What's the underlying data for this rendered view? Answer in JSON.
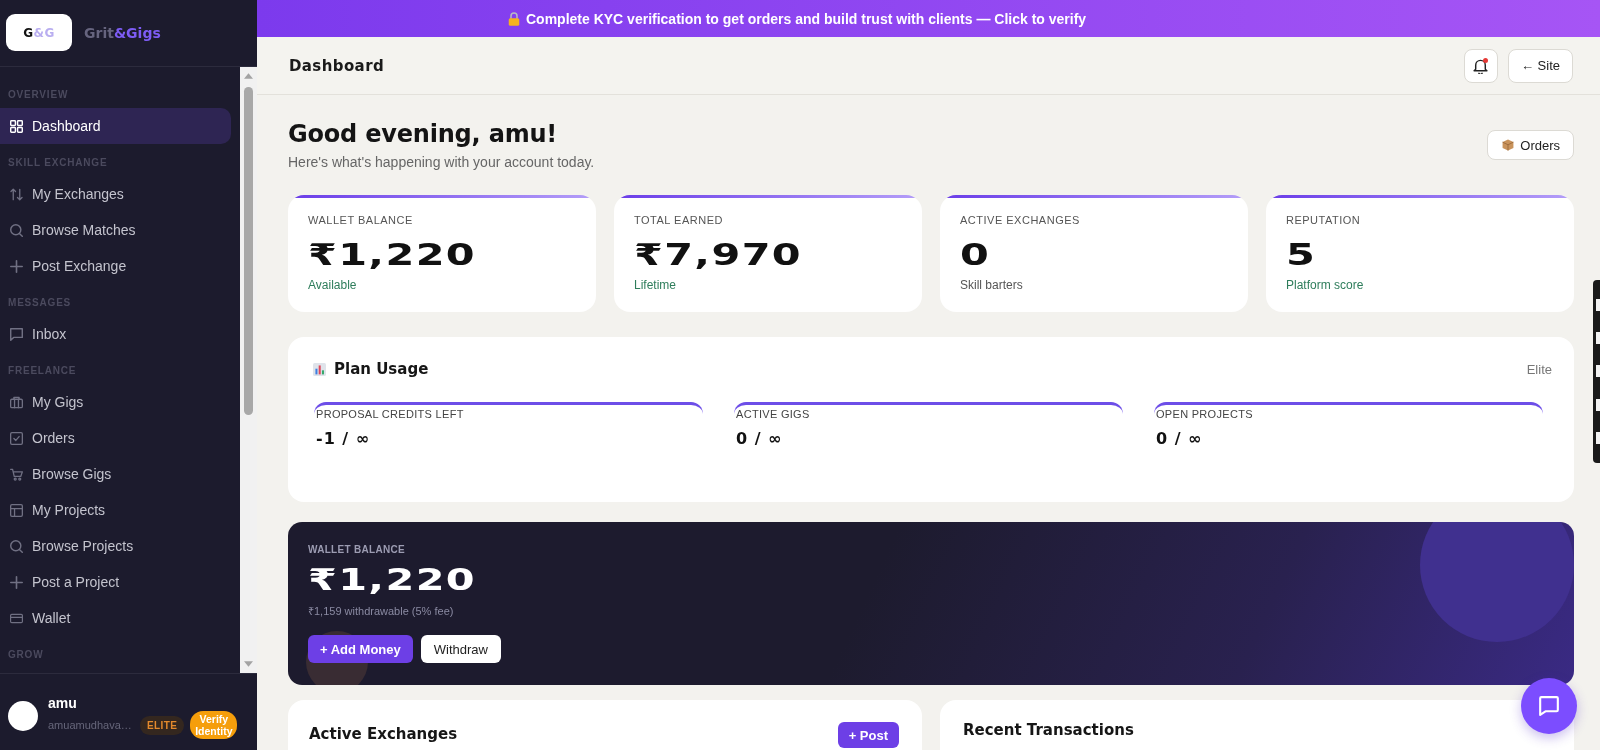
{
  "banner": {
    "text": "Complete KYC verification to get orders and build trust with clients — Click to verify"
  },
  "sidebar": {
    "logo_mark": {
      "dark": "G",
      "accent": "&G"
    },
    "brand_name": {
      "dark": "Grit",
      "accent": "&Gigs"
    },
    "sections": [
      {
        "label": "OVERVIEW",
        "items": [
          {
            "label": "Dashboard",
            "selected": true
          }
        ]
      },
      {
        "label": "SKILL EXCHANGE",
        "items": [
          {
            "label": "My Exchanges",
            "selected": false
          },
          {
            "label": "Browse Matches",
            "selected": false
          },
          {
            "label": "Post Exchange",
            "selected": false
          }
        ]
      },
      {
        "label": "MESSAGES",
        "items": [
          {
            "label": "Inbox",
            "selected": false
          }
        ]
      },
      {
        "label": "FREELANCE",
        "items": [
          {
            "label": "My Gigs",
            "selected": false
          },
          {
            "label": "Orders",
            "selected": false
          },
          {
            "label": "Browse Gigs",
            "selected": false
          },
          {
            "label": "My Projects",
            "selected": false
          },
          {
            "label": "Browse Projects",
            "selected": false
          },
          {
            "label": "Post a Project",
            "selected": false
          },
          {
            "label": "Wallet",
            "selected": false
          }
        ]
      },
      {
        "label": "GROW"
      }
    ],
    "user": {
      "name": "amu",
      "email": "amuamudhava…",
      "badge": "ELITE",
      "verify_button": "Verify Identity"
    }
  },
  "header": {
    "title": "Dashboard",
    "has_unread": true,
    "site_button": "← Site"
  },
  "greeting": {
    "title": "Good evening, amu!",
    "subtitle": "Here's what's happening with your account today.",
    "orders_button": "Orders"
  },
  "stats": [
    {
      "label": "WALLET BALANCE",
      "value": "₹1,220",
      "note": "Available",
      "color": "#2e7d5b"
    },
    {
      "label": "TOTAL EARNED",
      "value": "₹7,970",
      "note": "Lifetime",
      "color": "#2e7d5b"
    },
    {
      "label": "ACTIVE EXCHANGES",
      "value": "0",
      "note": "Skill barters",
      "color": "#555555"
    },
    {
      "label": "REPUTATION",
      "value": "5",
      "note": "Platform score",
      "color": "#2e7d5b"
    }
  ],
  "plan_usage": {
    "title": "Plan Usage",
    "plan": "Elite",
    "meters": [
      {
        "label": "PROPOSAL CREDITS LEFT",
        "value": "-1 / ∞"
      },
      {
        "label": "ACTIVE GIGS",
        "value": "0 / ∞"
      },
      {
        "label": "OPEN PROJECTS",
        "value": "0 / ∞"
      }
    ]
  },
  "wallet": {
    "label": "WALLET BALANCE",
    "amount": "₹1,220",
    "note": "₹1,159 withdrawable (5% fee)",
    "buttons": [
      {
        "label": "+ Add Money",
        "kind": "primary"
      },
      {
        "label": "Withdraw",
        "kind": "secondary"
      }
    ]
  },
  "active_exchanges": {
    "title": "Active Exchanges",
    "button": "+ Post"
  },
  "recent_transactions": {
    "title": "Recent Transactions"
  }
}
